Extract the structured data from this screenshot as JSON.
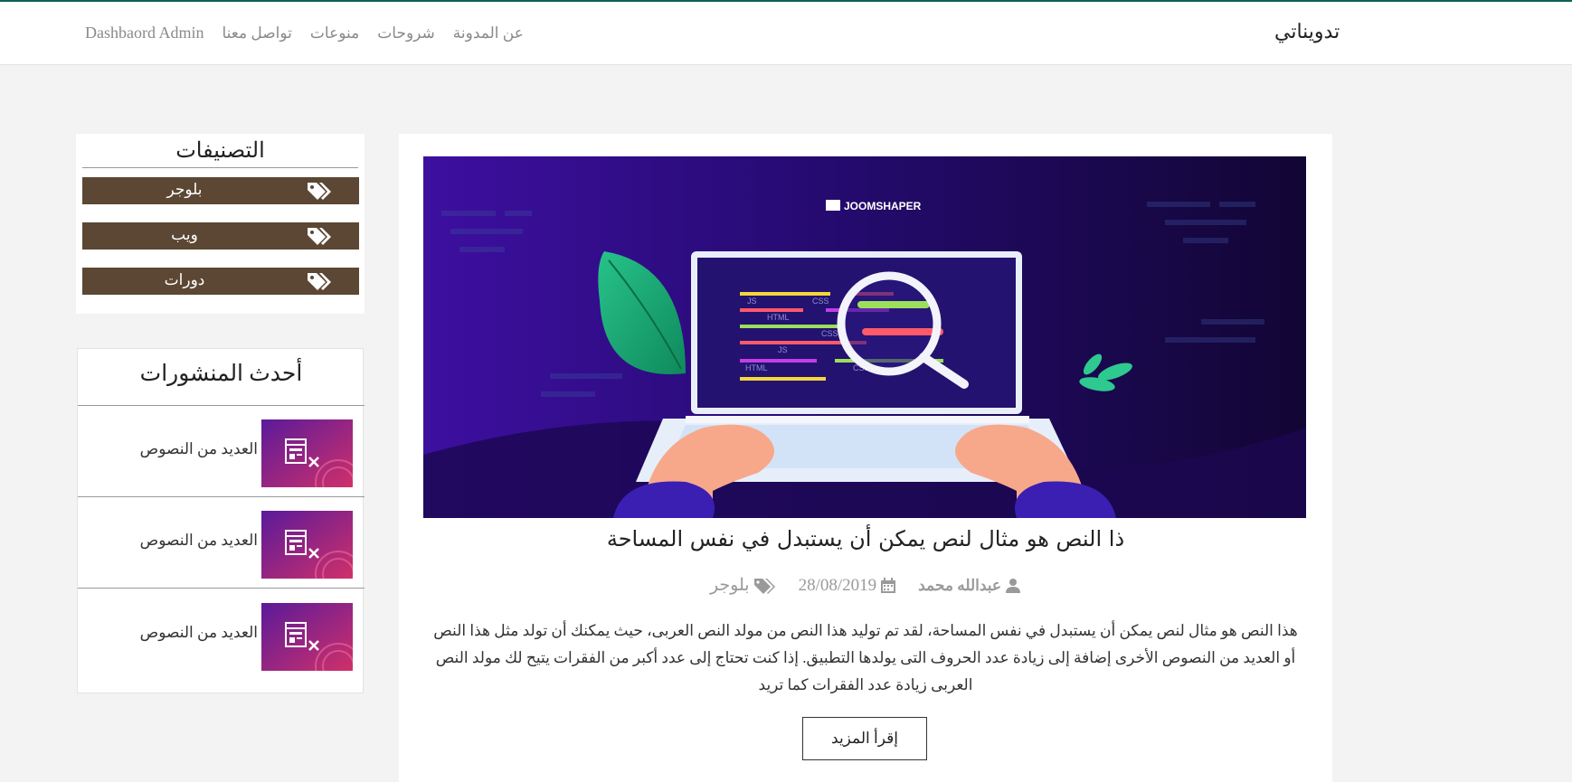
{
  "header": {
    "brand": "تدويناتي",
    "nav": [
      {
        "label": "Dashbaord Admin"
      },
      {
        "label": "تواصل معنا"
      },
      {
        "label": "منوعات"
      },
      {
        "label": "شروحات"
      },
      {
        "label": "عن المدونة"
      }
    ]
  },
  "post": {
    "image_brand": "JOOMSHAPER",
    "code_labels": [
      "JS",
      "CSS",
      "HTML",
      "CSS",
      "JS",
      "HTML",
      "CSS"
    ],
    "title": "ذا النص هو مثال لنص يمكن أن يستبدل في نفس المساحة",
    "author": "عبدالله محمد",
    "date": "28/08/2019",
    "category": "بلوجر",
    "excerpt": "هذا النص هو مثال لنص يمكن أن يستبدل في نفس المساحة، لقد تم توليد هذا النص من مولد النص العربى، حيث يمكنك أن تولد مثل هذا النص أو العديد من النصوص الأخرى إضافة إلى زيادة عدد الحروف التى يولدها التطبيق. إذا كنت تحتاج إلى عدد أكبر من الفقرات يتيح لك مولد النص العربى زيادة عدد الفقرات كما تريد",
    "read_more": "إقرأ المزيد"
  },
  "categories": {
    "title": "التصنيفات",
    "items": [
      {
        "label": "بلوجر",
        "icon": "tags-icon"
      },
      {
        "label": "ويب",
        "icon": "tags-icon"
      },
      {
        "label": "دورات",
        "icon": "tags-icon"
      }
    ]
  },
  "latest": {
    "title": "أحدث المنشورات",
    "items": [
      {
        "title": "العديد من النصوص"
      },
      {
        "title": "العديد من النصوص"
      },
      {
        "title": "العديد من النصوص"
      }
    ]
  },
  "colors": {
    "accent_top": "#0f6157",
    "category_button": "#5b4733"
  }
}
